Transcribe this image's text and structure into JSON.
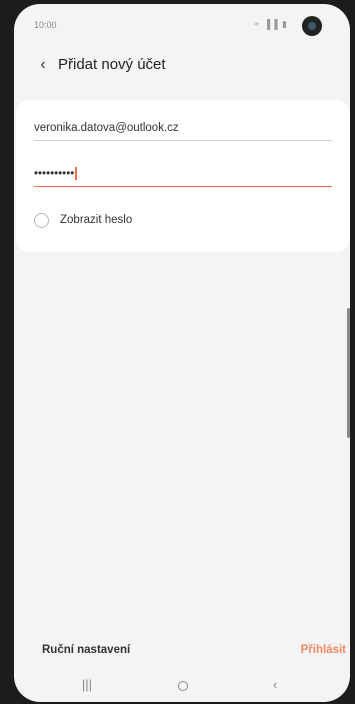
{
  "status_bar": {
    "time": "10:00",
    "icons": "≈ ▐▐ ▮",
    "icon_names": [
      "wifi-icon",
      "signal-icon",
      "battery-icon"
    ]
  },
  "app_bar": {
    "back_icon": "‹",
    "title": "Přidat nový účet"
  },
  "form": {
    "email_value": "veronika.datova@outlook.cz",
    "password_value": "••••••••••",
    "show_password_label": "Zobrazit heslo",
    "show_password_checked": false
  },
  "actions": {
    "manual_setup_label": "Ruční nastavení",
    "login_label": "Přihlásit"
  },
  "nav": {
    "recents_icon": "|||",
    "back_icon": "‹"
  },
  "colors": {
    "accent": "#e8704e",
    "login_text": "#f08a64",
    "background": "#f4f4f4",
    "card": "#ffffff"
  }
}
